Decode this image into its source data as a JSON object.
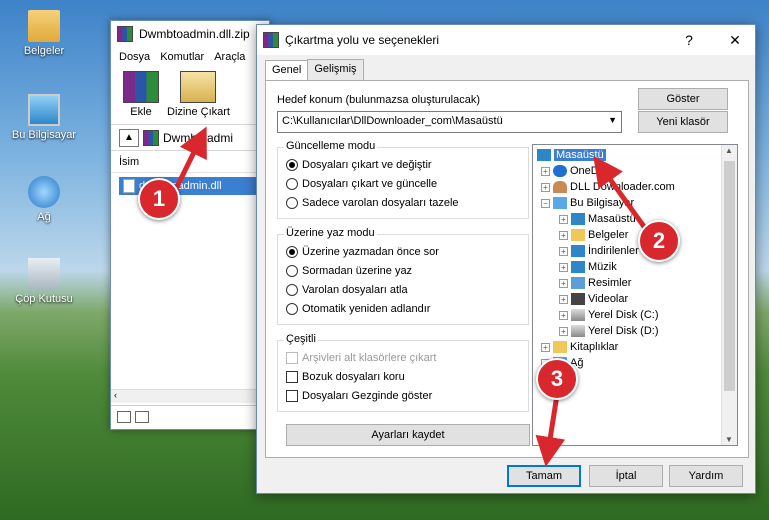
{
  "desktop": {
    "icons": [
      {
        "label": "Belgeler",
        "icon": "folder-documents-icon"
      },
      {
        "label": "Bu Bilgisayar",
        "icon": "computer-icon"
      },
      {
        "label": "Ağ",
        "icon": "network-icon"
      },
      {
        "label": "Çöp Kutusu",
        "icon": "recycle-bin-icon"
      }
    ]
  },
  "app": {
    "title": "Dwmbtoadmin.dll.zip",
    "menu": [
      "Dosya",
      "Komutlar",
      "Araçla"
    ],
    "toolbar": {
      "add_label": "Ekle",
      "extract_label": "Dizine Çıkart"
    },
    "path": "Dwmbtoadmi",
    "column_name": "İsim",
    "file_name": "dwmbtoadmin.dll"
  },
  "dialog": {
    "title": "Çıkartma yolu ve seçenekleri",
    "help": "?",
    "close": "✕",
    "tabs": [
      "Genel",
      "Gelişmiş"
    ],
    "target_label": "Hedef konum (bulunmazsa oluşturulacak)",
    "target_value": "C:\\Kullanıcılar\\DllDownloader_com\\Masaüstü",
    "show_button": "Göster",
    "new_folder_button": "Yeni klasör",
    "update_group": {
      "title": "Güncelleme modu",
      "options": [
        "Dosyaları çıkart ve değiştir",
        "Dosyaları çıkart ve güncelle",
        "Sadece varolan dosyaları tazele"
      ],
      "selected": 0
    },
    "overwrite_group": {
      "title": "Üzerine yaz modu",
      "options": [
        "Üzerine yazmadan önce sor",
        "Sormadan üzerine yaz",
        "Varolan dosyaları atla",
        "Otomatik yeniden adlandır"
      ],
      "selected": 0
    },
    "misc_group": {
      "title": "Çeşitli",
      "options": [
        "Arşivleri alt klasörlere çıkart",
        "Bozuk dosyaları koru",
        "Dosyaları Gezginde göster"
      ]
    },
    "save_settings_button": "Ayarları kaydet",
    "tree": [
      "Masaüstü",
      "OneDrive",
      "DLL Downloader.com",
      "Bu Bilgisayar",
      "Masaüstü",
      "Belgeler",
      "İndirilenler",
      "Müzik",
      "Resimler",
      "Videolar",
      "Yerel Disk (C:)",
      "Yerel Disk (D:)",
      "Kitaplıklar",
      "Ağ"
    ],
    "ok_button": "Tamam",
    "cancel_button": "İptal",
    "help_button": "Yardım"
  },
  "annotations": {
    "step1": "1",
    "step2": "2",
    "step3": "3"
  },
  "colors": {
    "marker": "#d9272e",
    "selection": "#3b7fd0"
  }
}
